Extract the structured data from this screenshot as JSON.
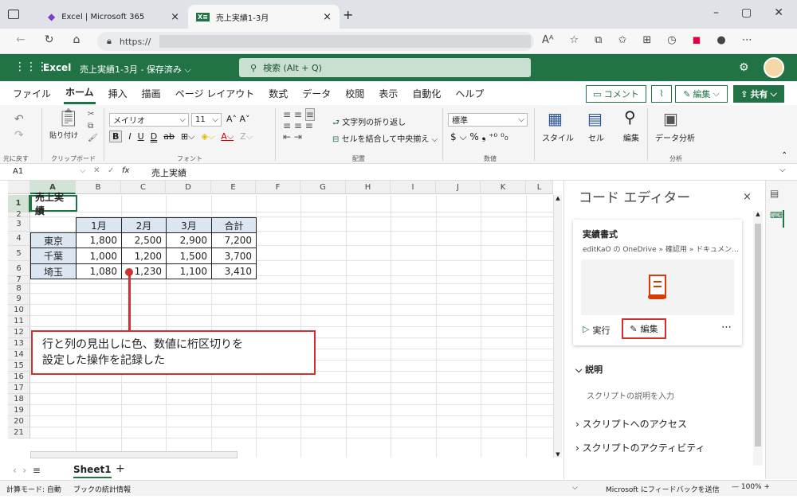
{
  "browser": {
    "tab1": "Excel | Microsoft 365",
    "tab2": "売上実績1-3月",
    "url": "https://",
    "close": "×",
    "new_tab": "+"
  },
  "excel": {
    "app": "Excel",
    "filename": "売上実績1-3月 - 保存済み",
    "search": "検索 (Alt + Q)"
  },
  "menus": [
    "ファイル",
    "ホーム",
    "挿入",
    "描画",
    "ページ レイアウト",
    "数式",
    "データ",
    "校閲",
    "表示",
    "自動化",
    "ヘルプ"
  ],
  "ribbon": {
    "comment": "コメント",
    "edit": "編集",
    "share": "共有",
    "paste": "貼り付け",
    "font": "メイリオ",
    "size": "11",
    "wrap": "文字列の折り返し",
    "merge": "セルを結合して中央揃え",
    "numfmt": "標準",
    "style": "スタイル",
    "cell": "セル",
    "edit2": "編集",
    "analysis": "データ分析",
    "grp_undo": "元に戻す",
    "grp_clip": "クリップボード",
    "grp_font": "フォント",
    "grp_align": "配置",
    "grp_num": "数値",
    "grp_anal": "分析"
  },
  "formula": {
    "namebox": "A1",
    "fx": "fx",
    "value": "売上実績"
  },
  "columns": [
    "A",
    "B",
    "C",
    "D",
    "E",
    "F",
    "G",
    "H",
    "I",
    "J",
    "K",
    "L"
  ],
  "rows": [
    "1",
    "2",
    "3",
    "4",
    "5",
    "6",
    "7",
    "8",
    "9",
    "10",
    "11",
    "12",
    "13",
    "14",
    "15",
    "16",
    "17",
    "18",
    "19",
    "20",
    "21"
  ],
  "table": {
    "title": "売上実績",
    "header": [
      "",
      "1月",
      "2月",
      "3月",
      "合計"
    ],
    "data": [
      [
        "東京",
        "1,800",
        "2,500",
        "2,900",
        "7,200"
      ],
      [
        "千葉",
        "1,000",
        "1,200",
        "1,500",
        "3,700"
      ],
      [
        "埼玉",
        "1,080",
        "1,230",
        "1,100",
        "3,410"
      ]
    ]
  },
  "callout": {
    "line1": "行と列の見出しに色、数値に桁区切りを",
    "line2": "設定した操作を記録した"
  },
  "sheet": {
    "name": "Sheet1",
    "add": "+"
  },
  "status": {
    "calc": "計算モード: 自動",
    "stats": "ブックの統計情報",
    "feedback": "Microsoft にフィードバックを送信",
    "zoom": "100%"
  },
  "panel": {
    "title": "コード エディター",
    "script_name": "実績書式",
    "path": "editKaO の OneDrive » 確認用 » ドキュメン…",
    "run": "実行",
    "edit": "編集",
    "desc_hdr": "説明",
    "desc_ph": "スクリプトの説明を入力",
    "access": "スクリプトへのアクセス",
    "activity": "スクリプトのアクティビティ"
  },
  "colors": {
    "excel_green": "#217346",
    "header_fill": "#dce6f1",
    "callout": "#d32f2f"
  }
}
